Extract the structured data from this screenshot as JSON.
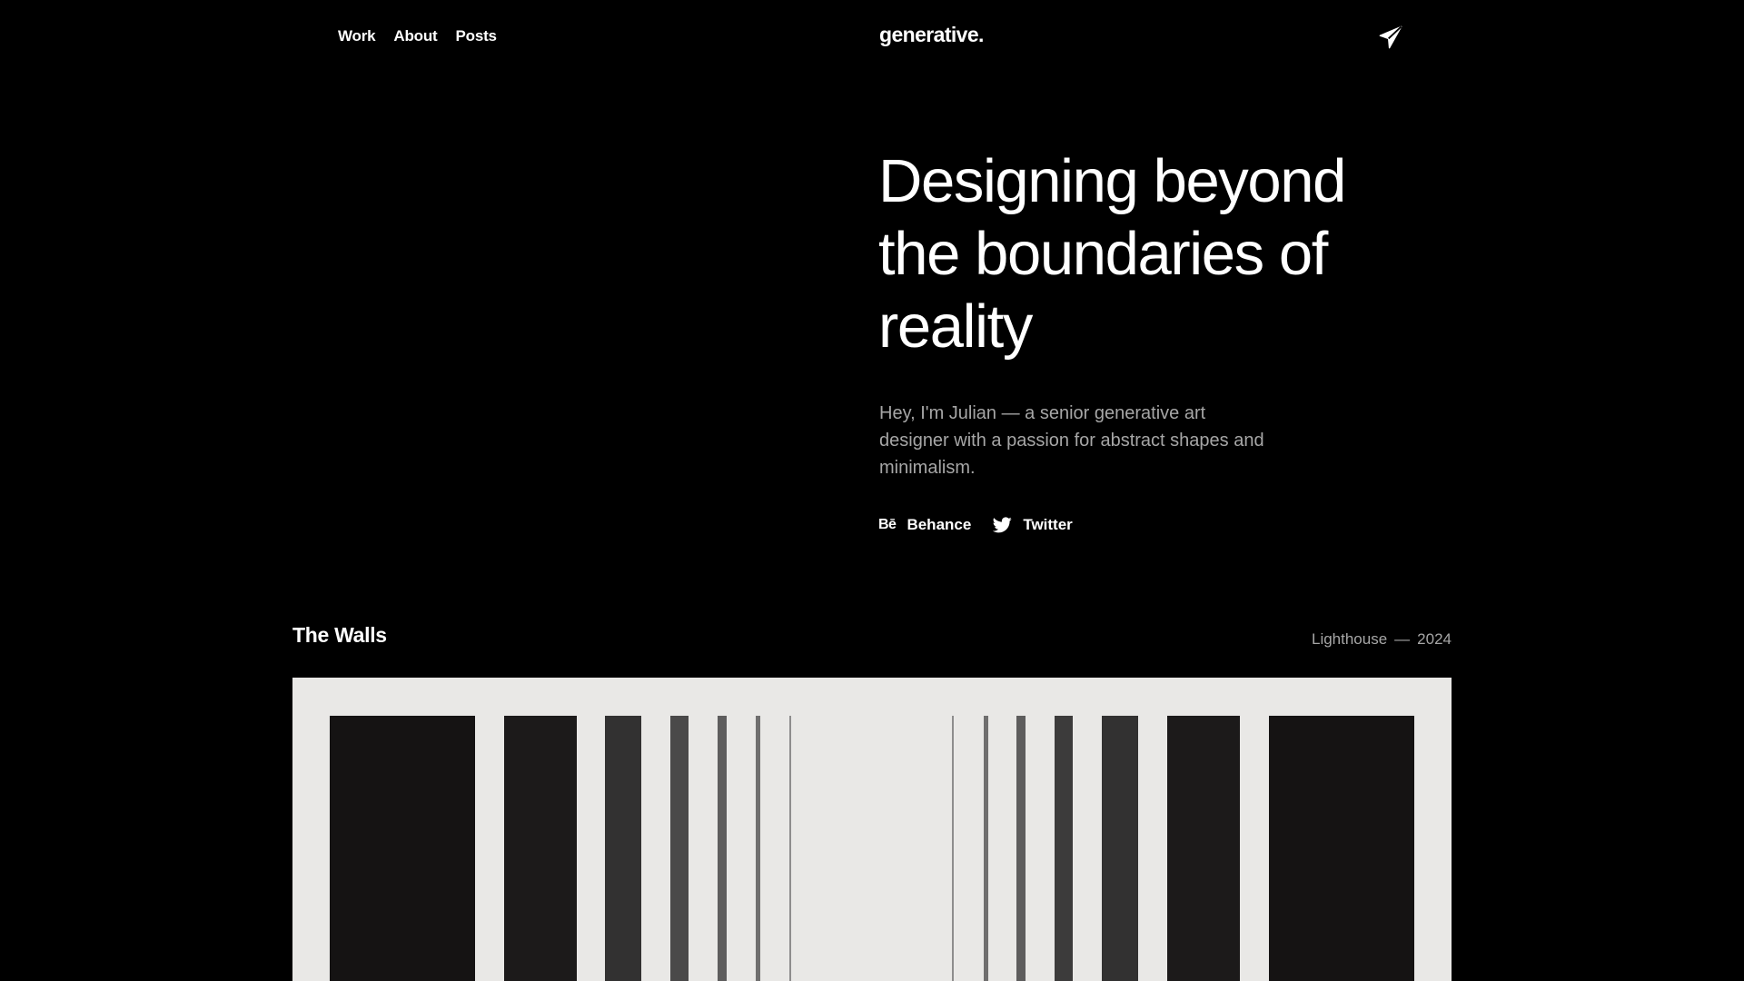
{
  "nav": {
    "links": [
      "Work",
      "About",
      "Posts"
    ],
    "brand": "generative.",
    "contact_icon": "paper-plane-icon"
  },
  "hero": {
    "title_lines": [
      "Designing beyond",
      "the boundaries of",
      "reality"
    ],
    "description": "Hey, I'm Julian — a senior generative art designer with a passion for abstract shapes and minimalism.",
    "socials": [
      {
        "icon_text": "Bē",
        "label": "Behance",
        "icon": "behance-icon"
      },
      {
        "label": "Twitter",
        "icon": "twitter-icon"
      }
    ]
  },
  "project": {
    "title": "The Walls",
    "client": "Lighthouse",
    "separator": "—",
    "year": "2024",
    "artwork_bars": [
      {
        "shade": "#151313"
      },
      {
        "shade": "#1c1a1a"
      },
      {
        "shade": "#323131"
      },
      {
        "shade": "#4a4949"
      },
      {
        "shade": "#5e5d5d"
      },
      {
        "shade": "#6f6e6e"
      },
      {
        "shade": "#8e8d8d"
      },
      {
        "shade": "#8e8d8d"
      },
      {
        "shade": "#6f6e6e"
      },
      {
        "shade": "#5e5d5d"
      },
      {
        "shade": "#3c3b3b"
      },
      {
        "shade": "#323131"
      },
      {
        "shade": "#1c1a1a"
      },
      {
        "shade": "#151313"
      }
    ]
  },
  "colors": {
    "background": "#000000",
    "text": "#ffffff",
    "muted": "#a6a6a6",
    "artwork_paper": "#e9e8e6"
  }
}
